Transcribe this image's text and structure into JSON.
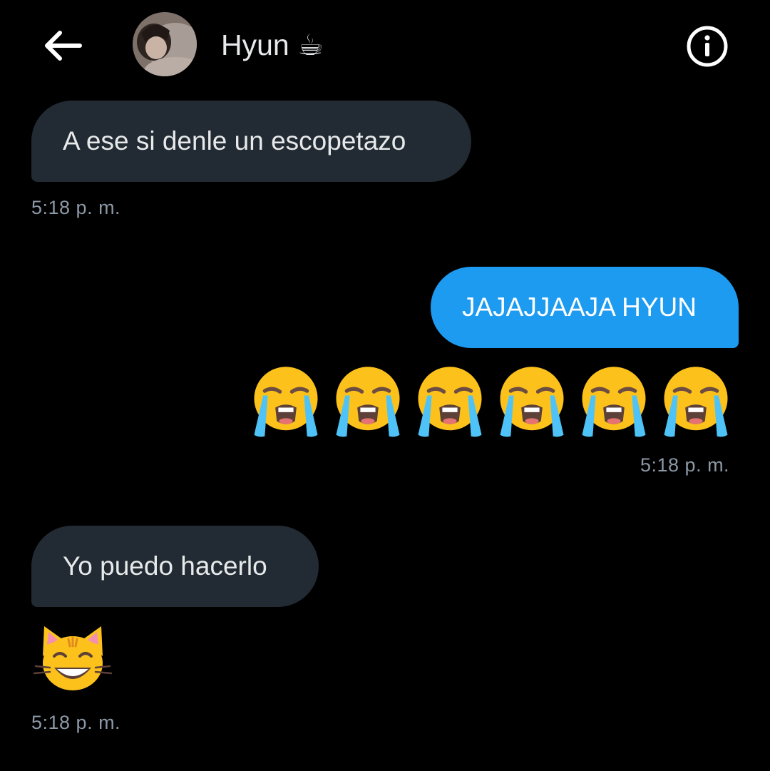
{
  "header": {
    "back_icon": "arrow-left-icon",
    "contact_name": "Hyun ☕",
    "info_icon": "info-icon"
  },
  "messages": [
    {
      "direction": "incoming",
      "text": "A ese si denle un escopetazo",
      "time": "5:18 p. m."
    },
    {
      "direction": "outgoing",
      "text": "JAJAJJAAJA HYUN",
      "emoji": "😭😭😭😭😭😭",
      "time": "5:18 p. m."
    },
    {
      "direction": "incoming",
      "text": "Yo puedo hacerlo",
      "emoji": "😸",
      "time": "5:18 p. m."
    }
  ],
  "colors": {
    "background": "#000000",
    "incoming_bubble": "#222b33",
    "outgoing_bubble": "#1d9bf0",
    "timestamp": "#8b98a5"
  }
}
